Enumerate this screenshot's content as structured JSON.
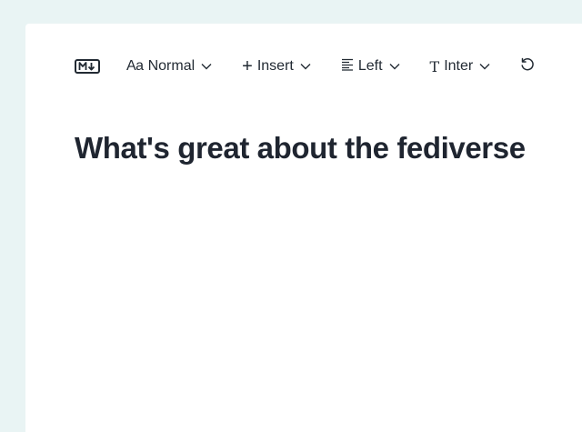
{
  "toolbar": {
    "markdown_icon": "markdown-icon",
    "style": {
      "icon": "Aa",
      "label": "Normal"
    },
    "insert": {
      "icon": "+",
      "label": "Insert"
    },
    "align": {
      "icon": "align-left-icon",
      "label": "Left"
    },
    "font": {
      "icon": "T",
      "label": "Inter"
    },
    "undo_icon": "undo-icon"
  },
  "document": {
    "title": "What's great about the fediverse"
  },
  "colors": {
    "page_background": "#e9f4f4",
    "panel_background": "#ffffff",
    "text": "#1f2530"
  }
}
